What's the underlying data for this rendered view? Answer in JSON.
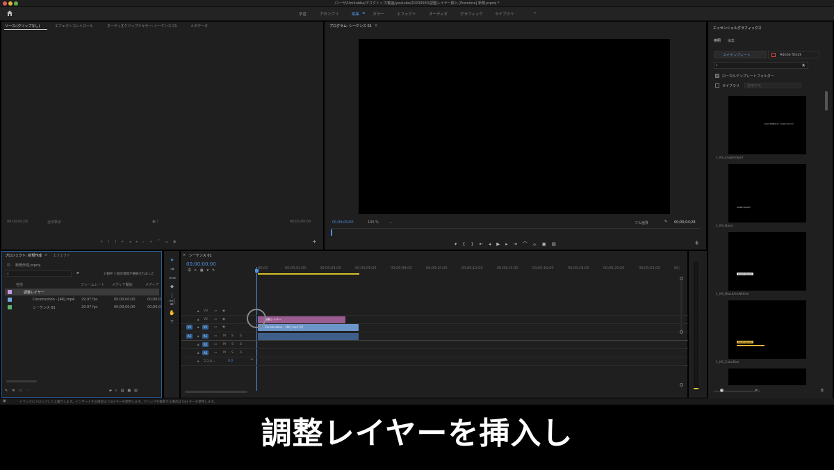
{
  "window": {
    "title": "/ユーザ/Umitubba/デスクトップ/動画/youtube/20200930/調整レイヤー挿入 [Premiere] 新規.prproj *"
  },
  "workspaces": [
    {
      "label": "学習",
      "active": false
    },
    {
      "label": "アセンブリ",
      "active": false
    },
    {
      "label": "編集",
      "active": true
    },
    {
      "label": "カラー",
      "active": false
    },
    {
      "label": "エフェクト",
      "active": false
    },
    {
      "label": "オーディオ",
      "active": false
    },
    {
      "label": "グラフィック",
      "active": false
    },
    {
      "label": "ライブラリ",
      "active": false
    }
  ],
  "source_panel": {
    "tabs": [
      "ソース:(クリップなし)",
      "エフェクトコントロール",
      "オーディオクリップミキサー: シーケンス 01",
      "メタデータ"
    ],
    "timecode_left": "00;00;00;00",
    "timecode_right": "00;00;00;00",
    "fit_label": "全体表示"
  },
  "program_panel": {
    "tab": "プログラム: シーケンス 01",
    "timecode_left": "00;00;00;00",
    "zoom": "100 %",
    "fit_label": "フル画質",
    "timecode_right": "00;00;04;28"
  },
  "project_panel": {
    "tabs": [
      "プロジェクト: 新規作成",
      "エフェクト"
    ],
    "project_file": "新規作成.prproj",
    "selection_info": "3 個中 1 個の項目が選択されました",
    "columns": [
      "名前",
      "フレームレート",
      "メディア開始",
      "メディア"
    ],
    "items": [
      {
        "name": "調整レイヤー",
        "fps": "",
        "start": "",
        "end": "",
        "color": "#c59ade",
        "selected": true
      },
      {
        "name": "Construction - [4K].mp4",
        "fps": "29.97 fps",
        "start": "00;00;00;00",
        "end": "00;00;0",
        "color": "#6fa7df",
        "selected": false
      },
      {
        "name": "シーケンス 01",
        "fps": "29.97 fps",
        "start": "00;00;00;00",
        "end": "00;00;0",
        "color": "#5fb36b",
        "selected": false
      }
    ]
  },
  "timeline": {
    "tab": "シーケンス 01",
    "timecode": "00;00;00;00",
    "ruler": [
      "00;00",
      "00;00;02;00",
      "00;00;04;00",
      "00;00;06;00",
      "00;00;08;00",
      "00;00;10;00",
      "00;00;12;00",
      "00;00;14;00",
      "00;00;16;00",
      "00;00;18;00",
      "00;00;20;00",
      "00;00;22;00",
      "00;"
    ],
    "video_tracks": [
      "V3",
      "V2",
      "V1"
    ],
    "audio_tracks": [
      "A1",
      "A2",
      "A3"
    ],
    "master_label": "マスター",
    "master_value": "0.0",
    "clips": {
      "adjustment": "調整レイヤー",
      "video": "Construction - [4K].mp4 [V]",
      "audio": ""
    }
  },
  "essential_graphics": {
    "title": "エッセンシャルグラフィックス",
    "tabs": [
      "参照",
      "編集"
    ],
    "buttons": [
      "マイテンプレート",
      "Adobe Stock"
    ],
    "checkbox_local": "ローカルテンプレートフォルダー",
    "checkbox_library": "ライブラリ",
    "library_placeholder": "使用不可",
    "templates": [
      {
        "name": "1_KS_EnglishSplit",
        "text": "John Mattera / Lorem Ipsum"
      },
      {
        "name": "1_KS_Basic",
        "text": "Lorem Ipsum"
      },
      {
        "name": "1_KS_BlackAndWhite",
        "text": "Lorem Ipsum"
      },
      {
        "name": "1_KS_ColorBox",
        "text": "Lorem Ipsum"
      }
    ]
  },
  "status_bar": "トラックにドロップして上書きします。インサートする場合は Cmd キーを使用します。クリップを複製する場合は Opt キーを使用します。",
  "caption": "調整レイヤーを挿入し",
  "colors": {
    "accent": "#4f8fe0",
    "adjustment_clip": "#9b5c92",
    "video_clip": "#6c95c9",
    "audio_clip": "#3e5f8b",
    "playhead": "#4f8fe0",
    "work_area": "#d4c22a"
  }
}
